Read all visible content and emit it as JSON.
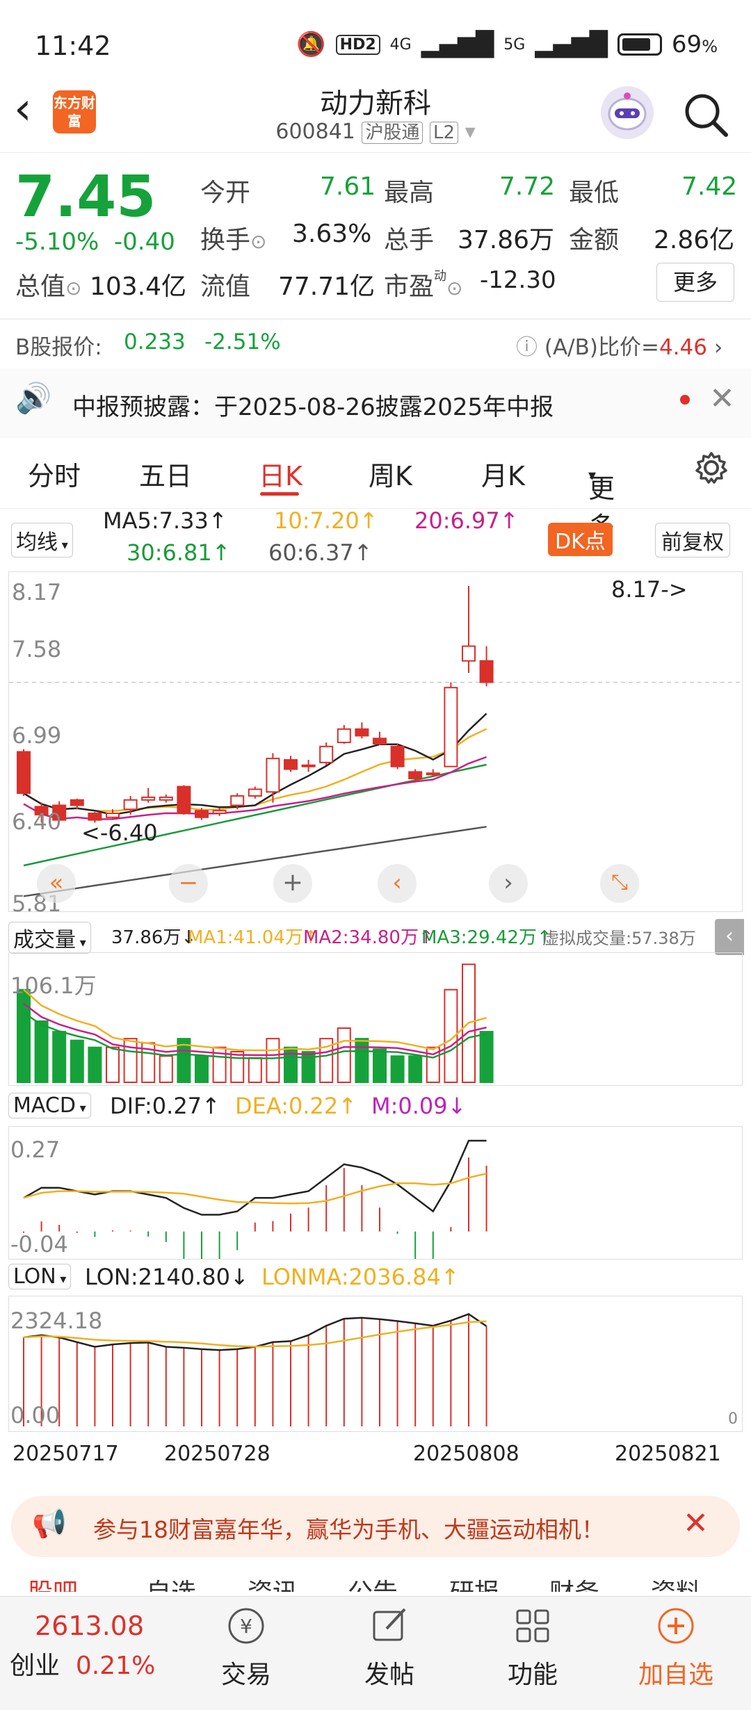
{
  "status": {
    "time": "11:42",
    "hd": "HD2",
    "net1": "4G",
    "net2": "5G",
    "battery": "69"
  },
  "header": {
    "back": "‹",
    "logo": "东方财富",
    "title": "动力新科",
    "code": "600841",
    "tag1": "沪股通",
    "tag2": "L2"
  },
  "quote": {
    "price": "7.45",
    "pct": "-5.10%",
    "chg": "-0.40",
    "open_l": "今开",
    "open": "7.61",
    "high_l": "最高",
    "high": "7.72",
    "low_l": "最低",
    "low": "7.42",
    "turn_l": "换手",
    "turn": "3.63%",
    "vol_l": "总手",
    "vol": "37.86万",
    "amt_l": "金额",
    "amt": "2.86亿",
    "mcap_l": "总值",
    "mcap": "103.4亿",
    "fcap_l": "流值",
    "fcap": "77.71亿",
    "pe_l": "市盈",
    "pe": "-12.30",
    "more": "更多"
  },
  "bshare": {
    "label": "B股报价:",
    "price": "0.233",
    "pct": "-2.51%",
    "ratio_l": "(A/B)比价=",
    "ratio": "4.46"
  },
  "notice": {
    "text": "中报预披露：于2025-08-26披露2025年中报"
  },
  "tabs": [
    "分时",
    "五日",
    "日K",
    "周K",
    "月K",
    "更多"
  ],
  "legend": {
    "type": "均线",
    "ma5": "MA5:7.33",
    "ma10": "10:7.20",
    "ma20": "20:6.97",
    "ma30": "30:6.81",
    "ma60": "60:6.37",
    "dk": "DK点",
    "fq": "前复权"
  },
  "kline": {
    "ymax": "8.17",
    "y2": "7.58",
    "y3": "6.99",
    "y4": "6.40",
    "ymin": "5.81",
    "hi_ann": "8.17->",
    "lo_ann": "<-6.40"
  },
  "volume": {
    "type": "成交量",
    "val": "37.86万",
    "ma1": "MA1:41.04万",
    "ma2": "MA2:34.80万",
    "ma3": "MA3:29.42万",
    "virt": "虚拟成交量:57.38万",
    "ymax": "106.1万"
  },
  "macd": {
    "type": "MACD",
    "dif": "DIF:0.27",
    "dea": "DEA:0.22",
    "m": "M:0.09",
    "ymax": "0.27",
    "ymin": "-0.04"
  },
  "lon": {
    "type": "LON",
    "lon": "LON:2140.80",
    "lonma": "LONMA:2036.84",
    "ymax": "2324.18",
    "ymin": "0.00",
    "zero": "0"
  },
  "dates": [
    "20250717",
    "20250728",
    "20250808",
    "20250821"
  ],
  "ad": {
    "text": "参与18财富嘉年华，赢华为手机、大疆运动相机！"
  },
  "subtabs": [
    "股吧",
    "自选",
    "资讯",
    "公告",
    "研报",
    "财务",
    "资料"
  ],
  "bottom": {
    "index_val": "2613.08",
    "index_name": "创业",
    "index_pct": "0.21%",
    "trade": "交易",
    "post": "发帖",
    "func": "功能",
    "add": "加自选"
  },
  "chart_data": {
    "type": "candlestick",
    "candles": [
      [
        6.93,
        6.62,
        6.95,
        6.6
      ],
      [
        6.52,
        6.46,
        6.55,
        6.4
      ],
      [
        6.53,
        6.42,
        6.56,
        6.4
      ],
      [
        6.57,
        6.53,
        6.58,
        6.5
      ],
      [
        6.47,
        6.42,
        6.48,
        6.4
      ],
      [
        6.44,
        6.47,
        6.5,
        6.42
      ],
      [
        6.5,
        6.57,
        6.6,
        6.46
      ],
      [
        6.57,
        6.59,
        6.66,
        6.55
      ],
      [
        6.57,
        6.59,
        6.61,
        6.55
      ],
      [
        6.67,
        6.47,
        6.68,
        6.46
      ],
      [
        6.49,
        6.44,
        6.51,
        6.42
      ],
      [
        6.47,
        6.49,
        6.51,
        6.45
      ],
      [
        6.53,
        6.6,
        6.62,
        6.5
      ],
      [
        6.6,
        6.65,
        6.67,
        6.58
      ],
      [
        6.63,
        6.88,
        6.92,
        6.55
      ],
      [
        6.87,
        6.8,
        6.9,
        6.78
      ],
      [
        6.83,
        6.82,
        6.87,
        6.78
      ],
      [
        6.85,
        6.97,
        7.0,
        6.83
      ],
      [
        7.0,
        7.1,
        7.13,
        6.99
      ],
      [
        7.1,
        7.05,
        7.15,
        7.03
      ],
      [
        7.03,
        6.99,
        7.08,
        6.98
      ],
      [
        6.97,
        6.82,
        6.99,
        6.8
      ],
      [
        6.78,
        6.73,
        6.8,
        6.7
      ],
      [
        6.76,
        6.77,
        6.8,
        6.74
      ],
      [
        6.82,
        7.41,
        7.45,
        6.82
      ],
      [
        7.61,
        7.72,
        8.17,
        7.52
      ],
      [
        7.61,
        7.45,
        7.72,
        7.42
      ]
    ],
    "volume": [
      106,
      70,
      58,
      48,
      40,
      40,
      50,
      45,
      30,
      50,
      30,
      40,
      35,
      28,
      50,
      40,
      35,
      50,
      62,
      50,
      38,
      30,
      30,
      40,
      106,
      135,
      58
    ],
    "macd_dif": [
      0.1,
      0.13,
      0.13,
      0.12,
      0.11,
      0.12,
      0.12,
      0.11,
      0.1,
      0.07,
      0.05,
      0.05,
      0.06,
      0.1,
      0.1,
      0.11,
      0.12,
      0.16,
      0.2,
      0.19,
      0.17,
      0.14,
      0.1,
      0.06,
      0.15,
      0.27,
      0.27
    ],
    "lon": [
      1900,
      1950,
      1900,
      1800,
      1700,
      1750,
      1780,
      1790,
      1700,
      1680,
      1650,
      1630,
      1650,
      1700,
      1800,
      1820,
      1950,
      2150,
      2300,
      2320,
      2290,
      2250,
      2200,
      2150,
      2260,
      2400,
      2140
    ]
  }
}
